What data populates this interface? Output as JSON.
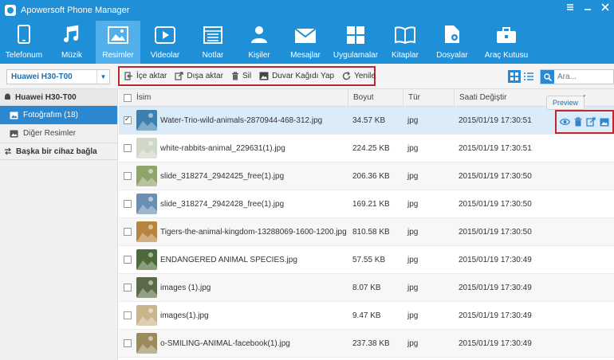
{
  "app": {
    "title": "Apowersoft Phone Manager"
  },
  "nav": [
    {
      "label": "Telefonum",
      "icon": "phone-icon"
    },
    {
      "label": "Müzik",
      "icon": "music-icon"
    },
    {
      "label": "Resimler",
      "icon": "image-icon",
      "active": true
    },
    {
      "label": "Videolar",
      "icon": "video-icon"
    },
    {
      "label": "Notlar",
      "icon": "notes-icon"
    },
    {
      "label": "Kişiler",
      "icon": "contacts-icon"
    },
    {
      "label": "Mesajlar",
      "icon": "messages-icon"
    },
    {
      "label": "Uygulamalar",
      "icon": "apps-icon"
    },
    {
      "label": "Kitaplar",
      "icon": "books-icon"
    },
    {
      "label": "Dosyalar",
      "icon": "files-icon"
    },
    {
      "label": "Araç Kutusu",
      "icon": "toolbox-icon"
    }
  ],
  "toolbar": {
    "device": "Huawei H30-T00",
    "import_label": "İçe aktar",
    "export_label": "Dışa aktar",
    "delete_label": "Sil",
    "wallpaper_label": "Duvar Kağıdı Yap",
    "refresh_label": "Yenile",
    "search_placeholder": "Ara..."
  },
  "sidebar": {
    "device": "Huawei H30-T00",
    "items": [
      {
        "label": "Fotoğrafım (18)",
        "active": true
      },
      {
        "label": "Diğer Resimler"
      }
    ],
    "connect_label": "Başka bir cihaz bağla"
  },
  "table": {
    "columns": {
      "name": "İsim",
      "size": "Boyut",
      "type": "Tür",
      "time": "Saati Değiştir",
      "extra": "r"
    },
    "tooltip": "Preview",
    "rows": [
      {
        "name": "Water-Trio-wild-animals-2870944-468-312.jpg",
        "size": "34.57 KB",
        "type": "jpg",
        "time": "2015/01/19 17:30:51",
        "checked": true,
        "thumb": "#3d7fb0"
      },
      {
        "name": "white-rabbits-animal_229631(1).jpg",
        "size": "224.25 KB",
        "type": "jpg",
        "time": "2015/01/19 17:30:51",
        "thumb": "#cfd7c6"
      },
      {
        "name": "slide_318274_2942425_free(1).jpg",
        "size": "206.36 KB",
        "type": "jpg",
        "time": "2015/01/19 17:30:50",
        "thumb": "#8fa46a"
      },
      {
        "name": "slide_318274_2942428_free(1).jpg",
        "size": "169.21 KB",
        "type": "jpg",
        "time": "2015/01/19 17:30:50",
        "thumb": "#6b8fb4"
      },
      {
        "name": "Tigers-the-animal-kingdom-13288069-1600-1200.jpg",
        "size": "810.58 KB",
        "type": "jpg",
        "time": "2015/01/19 17:30:50",
        "thumb": "#b7843f"
      },
      {
        "name": "ENDANGERED ANIMAL SPECIES.jpg",
        "size": "57.55 KB",
        "type": "jpg",
        "time": "2015/01/19 17:30:49",
        "thumb": "#4c6a3a"
      },
      {
        "name": "images (1).jpg",
        "size": "8.07 KB",
        "type": "jpg",
        "time": "2015/01/19 17:30:49",
        "thumb": "#5b6b4a"
      },
      {
        "name": "images(1).jpg",
        "size": "9.47 KB",
        "type": "jpg",
        "time": "2015/01/19 17:30:49",
        "thumb": "#c9b58b"
      },
      {
        "name": "o-SMILING-ANIMAL-facebook(1).jpg",
        "size": "237.38 KB",
        "type": "jpg",
        "time": "2015/01/19 17:30:49",
        "thumb": "#9b8a5c"
      }
    ]
  }
}
